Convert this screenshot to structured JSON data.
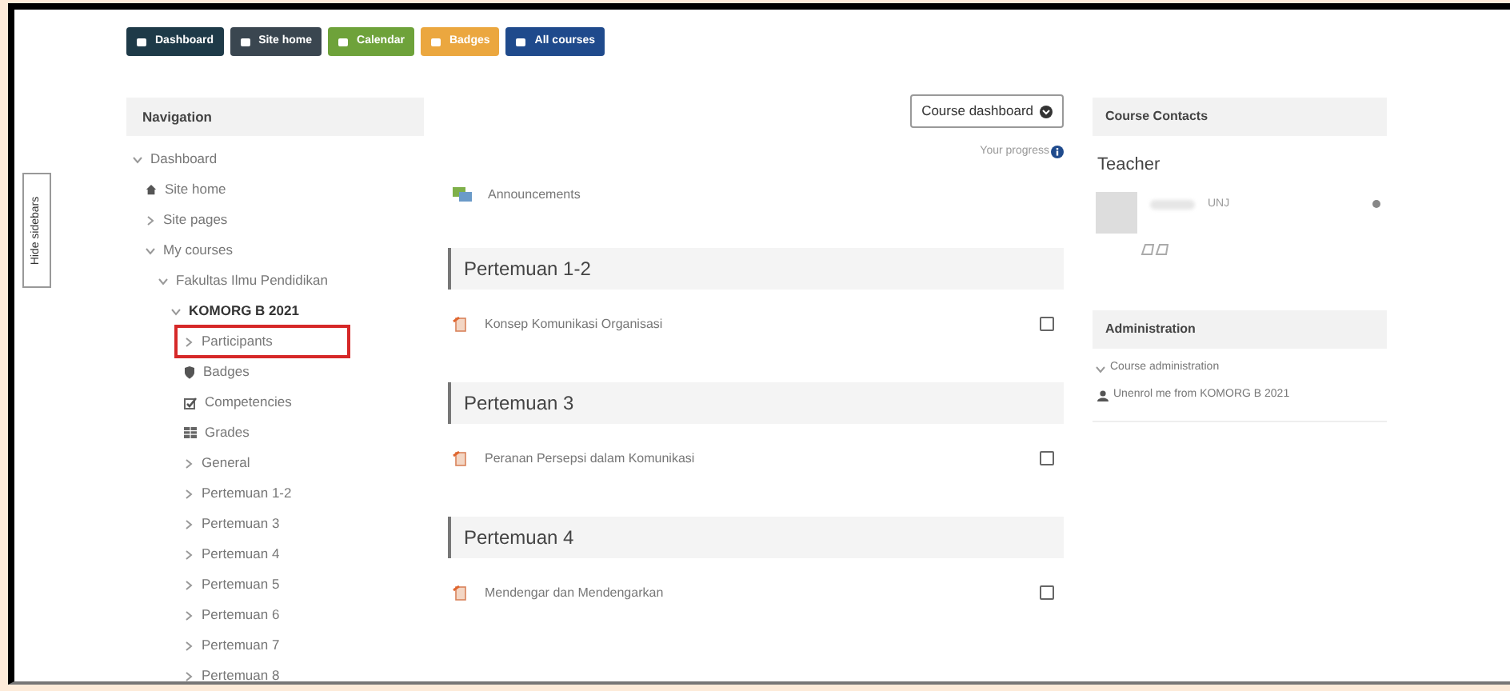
{
  "top_buttons": [
    {
      "label": "Dashboard",
      "color": "#1e3a48"
    },
    {
      "label": "Site home",
      "color": "#3a4650"
    },
    {
      "label": "Calendar",
      "color": "#6ea23a"
    },
    {
      "label": "Badges",
      "color": "#eba73f"
    },
    {
      "label": "All courses",
      "color": "#1f4a8c"
    }
  ],
  "hide_sidebars": "Hide sidebars",
  "navigation": {
    "title": "Navigation",
    "tree": [
      {
        "label": "Dashboard",
        "kind": "branch",
        "expanded": true,
        "bold": false,
        "highlighted": false,
        "children": [
          {
            "label": "Site home",
            "kind": "home",
            "expanded": false,
            "bold": false,
            "highlighted": false
          },
          {
            "label": "Site pages",
            "kind": "branch",
            "expanded": false,
            "bold": false,
            "highlighted": false
          },
          {
            "label": "My courses",
            "kind": "branch",
            "expanded": true,
            "bold": false,
            "highlighted": false,
            "children": [
              {
                "label": "Fakultas Ilmu Pendidikan",
                "kind": "branch",
                "expanded": true,
                "bold": false,
                "highlighted": false,
                "children": [
                  {
                    "label": "KOMORG B 2021",
                    "kind": "branch",
                    "expanded": true,
                    "bold": true,
                    "highlighted": false,
                    "children": [
                      {
                        "label": "Participants",
                        "kind": "branch",
                        "expanded": false,
                        "bold": false,
                        "highlighted": true
                      },
                      {
                        "label": "Badges",
                        "kind": "badge",
                        "expanded": false,
                        "bold": false,
                        "highlighted": false
                      },
                      {
                        "label": "Competencies",
                        "kind": "competency",
                        "expanded": false,
                        "bold": false,
                        "highlighted": false
                      },
                      {
                        "label": "Grades",
                        "kind": "grades",
                        "expanded": false,
                        "bold": false,
                        "highlighted": false
                      },
                      {
                        "label": "General",
                        "kind": "branch",
                        "expanded": false,
                        "bold": false,
                        "highlighted": false
                      },
                      {
                        "label": "Pertemuan 1-2",
                        "kind": "branch",
                        "expanded": false,
                        "bold": false,
                        "highlighted": false
                      },
                      {
                        "label": "Pertemuan 3",
                        "kind": "branch",
                        "expanded": false,
                        "bold": false,
                        "highlighted": false
                      },
                      {
                        "label": "Pertemuan 4",
                        "kind": "branch",
                        "expanded": false,
                        "bold": false,
                        "highlighted": false
                      },
                      {
                        "label": "Pertemuan 5",
                        "kind": "branch",
                        "expanded": false,
                        "bold": false,
                        "highlighted": false
                      },
                      {
                        "label": "Pertemuan 6",
                        "kind": "branch",
                        "expanded": false,
                        "bold": false,
                        "highlighted": false
                      },
                      {
                        "label": "Pertemuan 7",
                        "kind": "branch",
                        "expanded": false,
                        "bold": false,
                        "highlighted": false
                      },
                      {
                        "label": "Pertemuan 8",
                        "kind": "branch",
                        "expanded": false,
                        "bold": false,
                        "highlighted": false
                      }
                    ]
                  }
                ]
              }
            ]
          }
        ]
      }
    ]
  },
  "main": {
    "course_dashboard_button": "Course dashboard",
    "progress_label": "Your progress",
    "announcements": "Announcements",
    "sections": [
      {
        "title": "Pertemuan 1-2",
        "activities": [
          {
            "label": "Konsep Komunikasi Organisasi",
            "checked": false
          }
        ]
      },
      {
        "title": "Pertemuan 3",
        "activities": [
          {
            "label": "Peranan Persepsi dalam Komunikasi",
            "checked": false
          }
        ]
      },
      {
        "title": "Pertemuan 4",
        "activities": [
          {
            "label": "Mendengar dan Mendengarkan",
            "checked": false
          }
        ]
      }
    ]
  },
  "course_contacts": {
    "title": "Course Contacts",
    "role": "Teacher",
    "teacher_name": "UNJ"
  },
  "administration": {
    "title": "Administration",
    "items": [
      {
        "label": "Course administration",
        "kind": "branch",
        "expanded": true
      },
      {
        "label": "Unenrol me from KOMORG B 2021",
        "kind": "user"
      }
    ]
  }
}
